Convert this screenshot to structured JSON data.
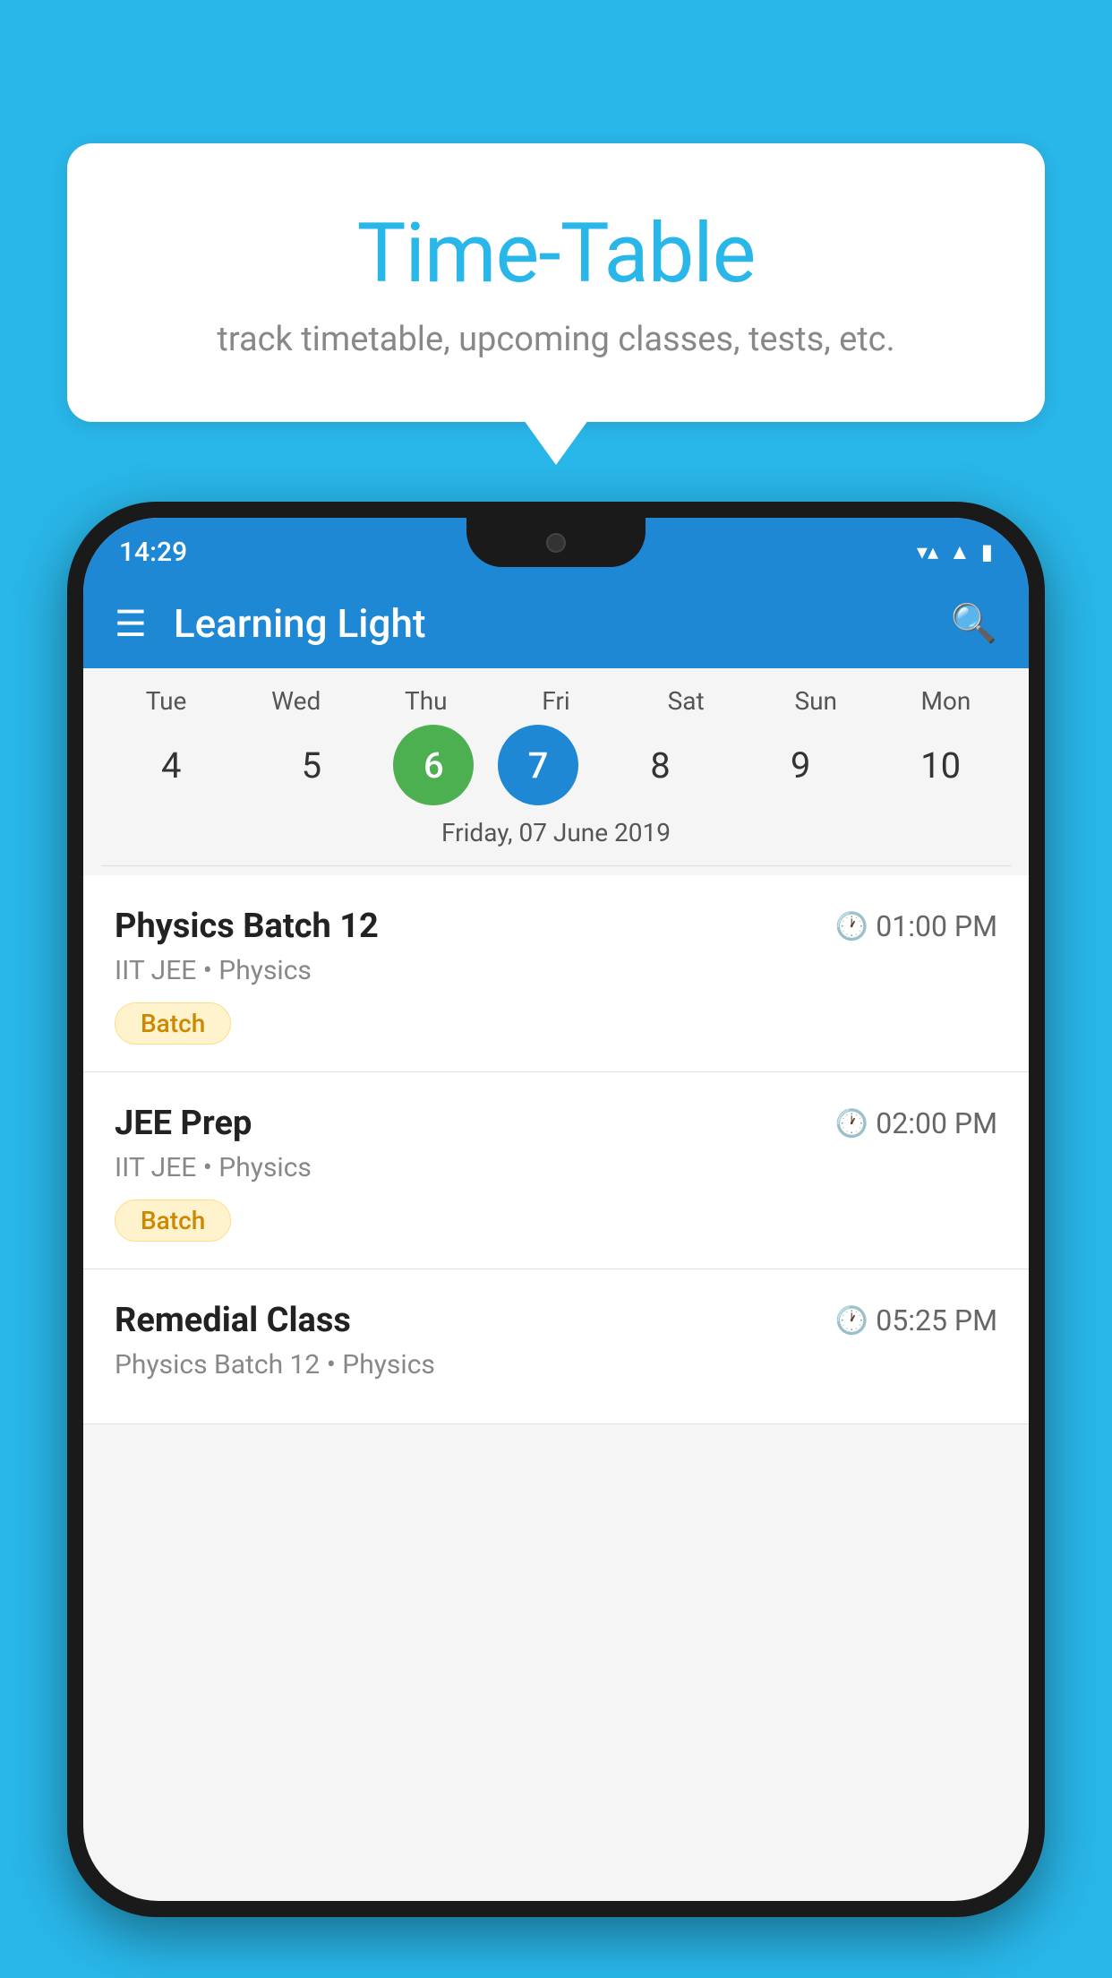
{
  "background_color": "#29B6E8",
  "bubble": {
    "title": "Time-Table",
    "subtitle": "track timetable, upcoming classes, tests, etc."
  },
  "status_bar": {
    "time": "14:29"
  },
  "app_bar": {
    "title": "Learning Light"
  },
  "calendar": {
    "days": [
      {
        "label": "Tue",
        "num": "4"
      },
      {
        "label": "Wed",
        "num": "5"
      },
      {
        "label": "Thu",
        "num": "6",
        "state": "today"
      },
      {
        "label": "Fri",
        "num": "7",
        "state": "selected"
      },
      {
        "label": "Sat",
        "num": "8"
      },
      {
        "label": "Sun",
        "num": "9"
      },
      {
        "label": "Mon",
        "num": "10"
      }
    ],
    "selected_date": "Friday, 07 June 2019"
  },
  "schedule": [
    {
      "name": "Physics Batch 12",
      "time": "01:00 PM",
      "subtitle": "IIT JEE • Physics",
      "badge": "Batch"
    },
    {
      "name": "JEE Prep",
      "time": "02:00 PM",
      "subtitle": "IIT JEE • Physics",
      "badge": "Batch"
    },
    {
      "name": "Remedial Class",
      "time": "05:25 PM",
      "subtitle": "Physics Batch 12 • Physics",
      "badge": null
    }
  ]
}
